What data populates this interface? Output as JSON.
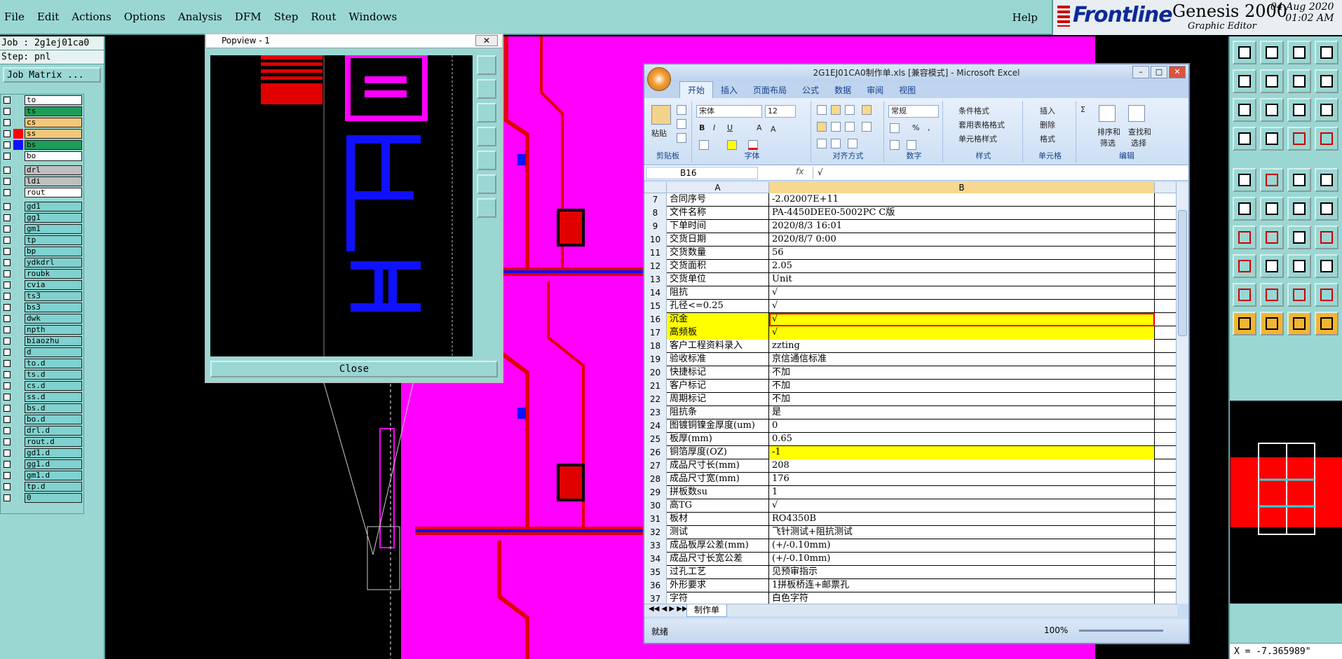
{
  "menubar": {
    "items": [
      "File",
      "Edit",
      "Actions",
      "Options",
      "Analysis",
      "DFM",
      "Step",
      "Rout",
      "Windows"
    ],
    "help": "Help"
  },
  "brand": {
    "logo": "Frontline",
    "product": "Genesis 2000",
    "subtitle": "Graphic Editor",
    "date": "04 Aug 2020",
    "time": "01:02 AM"
  },
  "job": {
    "job_line": "Job : 2g1ej01ca0",
    "step_line": "Step: pnl",
    "matrix_button": "Job Matrix ..."
  },
  "layers": [
    {
      "name": "to",
      "color": "#ffffff",
      "swatch": ""
    },
    {
      "name": "ts",
      "color": "#1f9e57",
      "swatch": ""
    },
    {
      "name": "cs",
      "color": "#f2c77a",
      "swatch": ""
    },
    {
      "name": "ss",
      "color": "#f2c77a",
      "swatch": "#ff0000"
    },
    {
      "name": "bs",
      "color": "#1f9e57",
      "swatch": "#1010ff"
    },
    {
      "name": "bo",
      "color": "#ffffff",
      "swatch": ""
    },
    {
      "name": "drl",
      "color": "#bfbfbf",
      "swatch": ""
    },
    {
      "name": "ldi",
      "color": "#bfbfbf",
      "swatch": ""
    },
    {
      "name": "rout",
      "color": "#ffffff",
      "swatch": ""
    },
    {
      "name": "gd1",
      "color": "#7fd2cf",
      "swatch": ""
    },
    {
      "name": "gg1",
      "color": "#7fd2cf",
      "swatch": ""
    },
    {
      "name": "gm1",
      "color": "#7fd2cf",
      "swatch": ""
    },
    {
      "name": "tp",
      "color": "#7fd2cf",
      "swatch": ""
    },
    {
      "name": "bp",
      "color": "#7fd2cf",
      "swatch": ""
    },
    {
      "name": "ydkdrl",
      "color": "#7fd2cf",
      "swatch": ""
    },
    {
      "name": "roubk",
      "color": "#7fd2cf",
      "swatch": ""
    },
    {
      "name": "cvia",
      "color": "#7fd2cf",
      "swatch": ""
    },
    {
      "name": "ts3",
      "color": "#7fd2cf",
      "swatch": ""
    },
    {
      "name": "bs3",
      "color": "#7fd2cf",
      "swatch": ""
    },
    {
      "name": "dwk",
      "color": "#7fd2cf",
      "swatch": ""
    },
    {
      "name": "npth",
      "color": "#7fd2cf",
      "swatch": ""
    },
    {
      "name": "biaozhu",
      "color": "#7fd2cf",
      "swatch": ""
    },
    {
      "name": "d",
      "color": "#7fd2cf",
      "swatch": ""
    },
    {
      "name": "to.d",
      "color": "#7fd2cf",
      "swatch": ""
    },
    {
      "name": "ts.d",
      "color": "#7fd2cf",
      "swatch": ""
    },
    {
      "name": "cs.d",
      "color": "#7fd2cf",
      "swatch": ""
    },
    {
      "name": "ss.d",
      "color": "#7fd2cf",
      "swatch": ""
    },
    {
      "name": "bs.d",
      "color": "#7fd2cf",
      "swatch": ""
    },
    {
      "name": "bo.d",
      "color": "#7fd2cf",
      "swatch": ""
    },
    {
      "name": "drl.d",
      "color": "#7fd2cf",
      "swatch": ""
    },
    {
      "name": "rout.d",
      "color": "#7fd2cf",
      "swatch": ""
    },
    {
      "name": "gd1.d",
      "color": "#7fd2cf",
      "swatch": ""
    },
    {
      "name": "gg1.d",
      "color": "#7fd2cf",
      "swatch": ""
    },
    {
      "name": "gm1.d",
      "color": "#7fd2cf",
      "swatch": ""
    },
    {
      "name": "tp.d",
      "color": "#7fd2cf",
      "swatch": ""
    },
    {
      "name": "0",
      "color": "#7fd2cf",
      "swatch": ""
    }
  ],
  "popview": {
    "title": "Popview - 1",
    "close_label": "Close",
    "close_x": "✕"
  },
  "excel": {
    "title": "2G1EJ01CA0制作单.xls [兼容模式] - Microsoft Excel",
    "tabs": [
      "开始",
      "插入",
      "页面布局",
      "公式",
      "数据",
      "审阅",
      "视图"
    ],
    "ribbon": {
      "paste": "粘贴",
      "clipboard": "剪贴板",
      "font_name": "宋体",
      "font_size": "12",
      "font": "字体",
      "align": "对齐方式",
      "number_format": "常规",
      "number": "数字",
      "cond_format": "条件格式",
      "table_format": "套用表格格式",
      "cell_style": "单元格样式",
      "styles": "样式",
      "insert": "插入",
      "delete": "删除",
      "format": "格式",
      "cells": "单元格",
      "sort": "排序和",
      "sort2": "筛选",
      "find": "查找和",
      "find2": "选择",
      "edit": "编辑"
    },
    "namebox": "B16",
    "fx": "fx",
    "formula": "√",
    "col_a": "A",
    "col_b": "B",
    "rows": [
      {
        "n": "7",
        "a": "合同序号",
        "b": "-2.02007E+11"
      },
      {
        "n": "8",
        "a": "文件名称",
        "b": "PA-4450DEE0-5002PC C版"
      },
      {
        "n": "9",
        "a": "下单时间",
        "b": "2020/8/3 16:01"
      },
      {
        "n": "10",
        "a": "交货日期",
        "b": "2020/8/7 0:00"
      },
      {
        "n": "11",
        "a": "交货数量",
        "b": "56"
      },
      {
        "n": "12",
        "a": "交货面积",
        "b": "2.05"
      },
      {
        "n": "13",
        "a": "交货单位",
        "b": "Unit"
      },
      {
        "n": "14",
        "a": "阻抗",
        "b": "√"
      },
      {
        "n": "15",
        "a": "孔径<=0.25",
        "b": "√"
      },
      {
        "n": "16",
        "a": "沉金",
        "b": "√"
      },
      {
        "n": "17",
        "a": "高频板",
        "b": "√"
      },
      {
        "n": "18",
        "a": "客户工程资料录入",
        "b": "zzting"
      },
      {
        "n": "19",
        "a": "验收标准",
        "b": "京信通信标准"
      },
      {
        "n": "20",
        "a": "快捷标记",
        "b": "不加"
      },
      {
        "n": "21",
        "a": "客户标记",
        "b": "不加"
      },
      {
        "n": "22",
        "a": "周期标记",
        "b": "不加"
      },
      {
        "n": "23",
        "a": "阻抗条",
        "b": "是"
      },
      {
        "n": "24",
        "a": "图镀铜镍金厚度(um)",
        "b": "0"
      },
      {
        "n": "25",
        "a": "板厚(mm)",
        "b": "0.65"
      },
      {
        "n": "26",
        "a": "铜箔厚度(OZ)",
        "b": "-1"
      },
      {
        "n": "27",
        "a": "成品尺寸长(mm)",
        "b": "208"
      },
      {
        "n": "28",
        "a": "成品尺寸宽(mm)",
        "b": "176"
      },
      {
        "n": "29",
        "a": "拼板数su",
        "b": "1"
      },
      {
        "n": "30",
        "a": "高TG",
        "b": "√"
      },
      {
        "n": "31",
        "a": "板材",
        "b": "RO4350B"
      },
      {
        "n": "32",
        "a": "测试",
        "b": "飞针测试+阻抗测试"
      },
      {
        "n": "33",
        "a": "成品板厚公差(mm)",
        "b": "(+/-0.10mm)"
      },
      {
        "n": "34",
        "a": "成品尺寸长宽公差",
        "b": "(+/-0.10mm)"
      },
      {
        "n": "35",
        "a": "过孔工艺",
        "b": "见预审指示"
      },
      {
        "n": "36",
        "a": "外形要求",
        "b": "1拼板桥连+邮票孔"
      },
      {
        "n": "37",
        "a": "字符",
        "b": "白色字符"
      }
    ],
    "sheet_tab": "制作单",
    "status_left": "就绪",
    "zoom": "100%"
  },
  "coord": "X = -7.365989\""
}
